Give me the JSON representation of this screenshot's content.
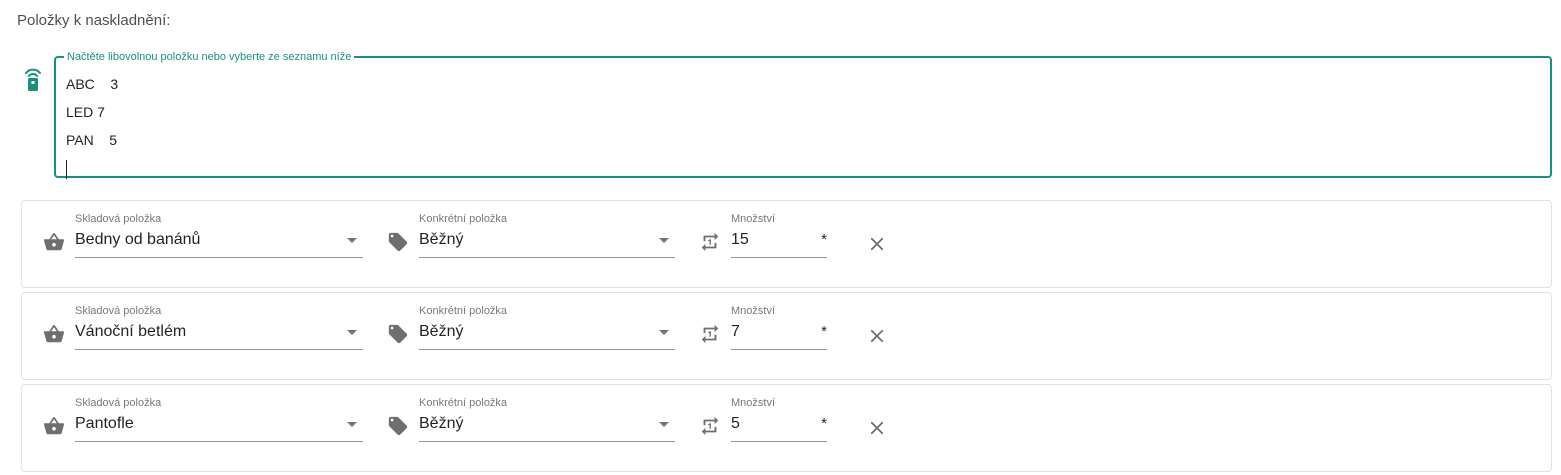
{
  "page": {
    "title": "Položky k naskladnění:"
  },
  "scan": {
    "legend": "Načtěte libovolnou položku nebo vyberte ze seznamu níže",
    "lines": [
      "ABC    3",
      "LED 7",
      "PAN    5"
    ],
    "accent_color": "#17907f"
  },
  "items_labels": {
    "stock_item": "Skladová položka",
    "specific_item": "Konkrétní položka",
    "quantity": "Množství",
    "required": "*"
  },
  "items": [
    {
      "stock_item": "Bedny od banánů",
      "specific_item": "Běžný",
      "quantity": "15"
    },
    {
      "stock_item": "Vánoční betlém",
      "specific_item": "Běžný",
      "quantity": "7"
    },
    {
      "stock_item": "Pantofle",
      "specific_item": "Běžný",
      "quantity": "5"
    }
  ],
  "icons": [
    "scanner-icon",
    "basket-icon",
    "tag-icon",
    "repeat-one-icon",
    "close-icon"
  ]
}
